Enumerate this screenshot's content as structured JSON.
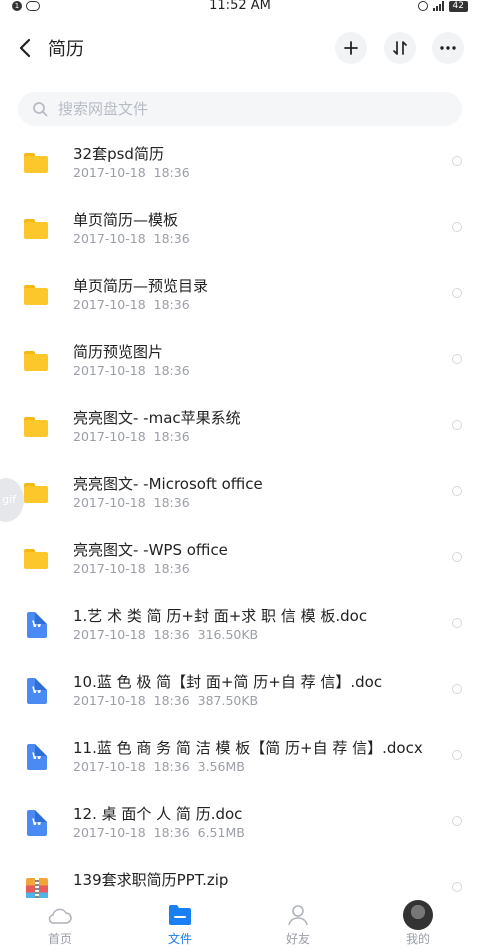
{
  "status_bar": {
    "time": "11:52 AM",
    "notification_badge": "1",
    "battery": "42"
  },
  "header": {
    "title": "简历"
  },
  "search": {
    "placeholder": "搜索网盘文件"
  },
  "files": [
    {
      "name": "32套psd简历",
      "date": "2017-10-18  18:36",
      "size": "",
      "type": "folder"
    },
    {
      "name": "单页简历—模板",
      "date": "2017-10-18  18:36",
      "size": "",
      "type": "folder"
    },
    {
      "name": "单页简历—预览目录",
      "date": "2017-10-18  18:36",
      "size": "",
      "type": "folder"
    },
    {
      "name": "简历预览图片",
      "date": "2017-10-18  18:36",
      "size": "",
      "type": "folder"
    },
    {
      "name": "亮亮图文- -mac苹果系统",
      "date": "2017-10-18  18:36",
      "size": "",
      "type": "folder"
    },
    {
      "name": "亮亮图文- -Microsoft office",
      "date": "2017-10-18  18:36",
      "size": "",
      "type": "folder"
    },
    {
      "name": "亮亮图文- -WPS office",
      "date": "2017-10-18  18:36",
      "size": "",
      "type": "folder"
    },
    {
      "name": "1.艺 术 类 简 历+封 面+求 职 信 模 板.doc",
      "date": "2017-10-18  18:36",
      "size": "316.50KB",
      "type": "doc"
    },
    {
      "name": "10.蓝 色 极 简【封 面+简 历+自 荐 信】.doc",
      "date": "2017-10-18  18:36",
      "size": "387.50KB",
      "type": "doc"
    },
    {
      "name": "11.蓝 色 商 务 简 洁 模 板【简 历+自 荐 信】.docx",
      "date": "2017-10-18  18:36",
      "size": "3.56MB",
      "type": "doc"
    },
    {
      "name": "12. 桌 面个 人 简 历.doc",
      "date": "2017-10-18  18:36",
      "size": "6.51MB",
      "type": "doc"
    },
    {
      "name": "139套求职简历PPT.zip",
      "date": "",
      "size": "",
      "type": "zip"
    }
  ],
  "floating": {
    "gif_label": "gif"
  },
  "bottom_nav": {
    "home": "首页",
    "files": "文件",
    "friends": "好友",
    "me": "我的"
  },
  "colors": {
    "accent": "#1a7ff2",
    "folder": "#fcc72a",
    "doc": "#4b8af3"
  }
}
